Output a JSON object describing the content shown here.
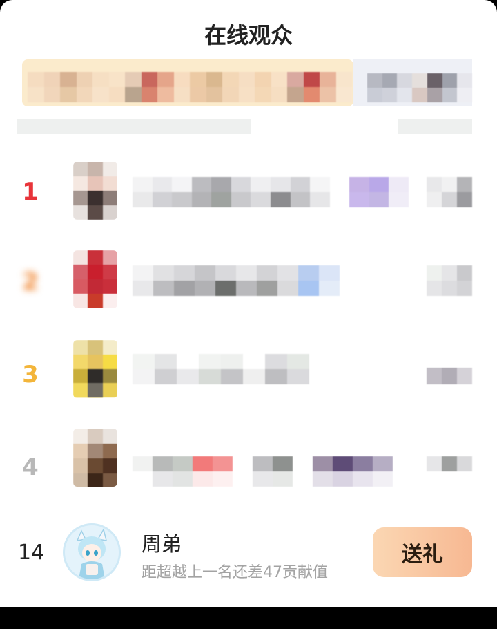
{
  "header": {
    "title": "在线观众"
  },
  "ranking": [
    {
      "rank": "1",
      "rank_color": "#e8343a"
    },
    {
      "rank": "2",
      "rank_color": "#f0842e"
    },
    {
      "rank": "3",
      "rank_color": "#f3b53a"
    },
    {
      "rank": "4",
      "rank_color": "#b8b8b8"
    }
  ],
  "my_entry": {
    "rank": "14",
    "name": "周弟",
    "subtitle": "距超越上一名还差47贡献值",
    "gift_button": "送礼"
  },
  "colors": {
    "gift_gradient_start": "#fbd7b3",
    "gift_gradient_end": "#f7b892"
  }
}
